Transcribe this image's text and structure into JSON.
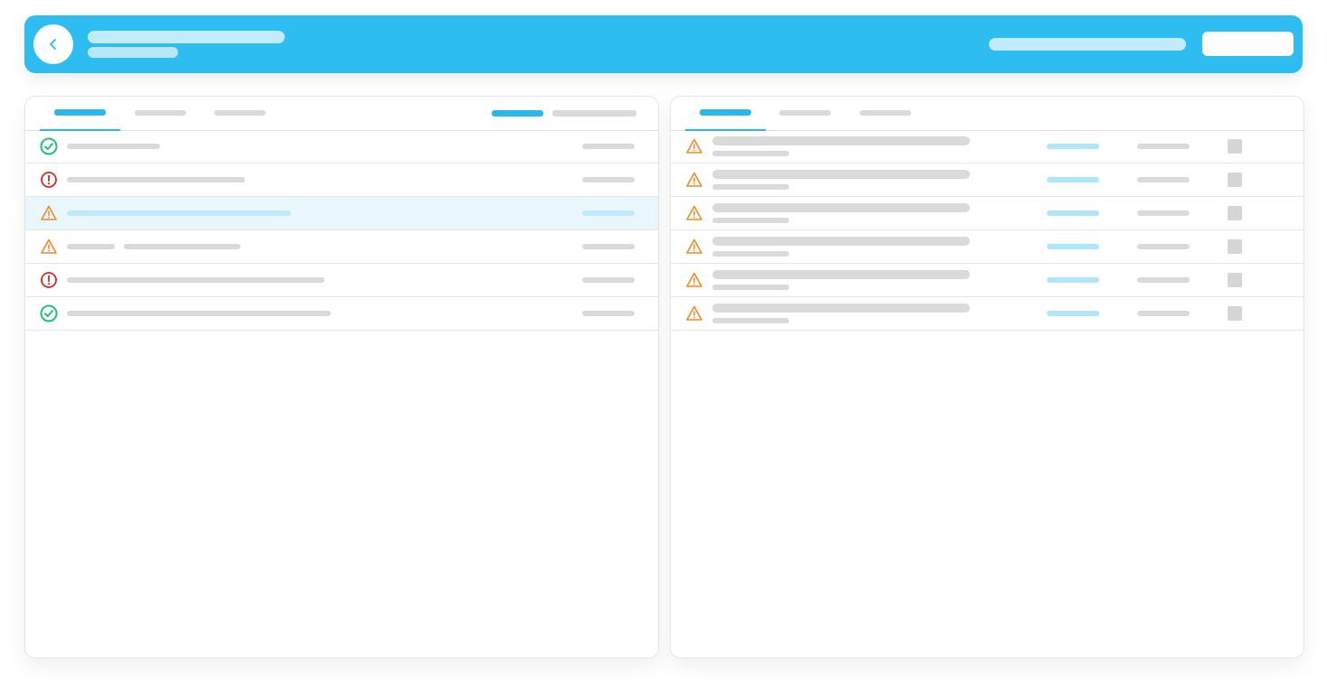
{
  "header": {
    "back_icon": "chevron-left-icon",
    "title": "",
    "subtitle": "",
    "meta": "",
    "action_label": ""
  },
  "left_panel": {
    "tabs": [
      {
        "label": "",
        "active": true
      },
      {
        "label": "",
        "active": false
      },
      {
        "label": "",
        "active": false
      }
    ],
    "toolbar": [
      {
        "label": "",
        "accent": true
      },
      {
        "label": "",
        "accent": false
      }
    ],
    "rows": [
      {
        "status": "success",
        "icon": "check-circle-icon",
        "text": "",
        "value": "",
        "highlighted": false
      },
      {
        "status": "error",
        "icon": "alert-circle-icon",
        "text": "",
        "value": "",
        "highlighted": false
      },
      {
        "status": "warning",
        "icon": "warning-triangle-icon",
        "text": "",
        "value": "",
        "highlighted": true
      },
      {
        "status": "warning",
        "icon": "warning-triangle-icon",
        "text": "",
        "text2": "",
        "value": "",
        "highlighted": false
      },
      {
        "status": "error",
        "icon": "alert-circle-icon",
        "text": "",
        "value": "",
        "highlighted": false
      },
      {
        "status": "success",
        "icon": "check-circle-icon",
        "text": "",
        "value": "",
        "highlighted": false
      }
    ]
  },
  "right_panel": {
    "tabs": [
      {
        "label": "",
        "active": true
      },
      {
        "label": "",
        "active": false
      },
      {
        "label": "",
        "active": false
      }
    ],
    "rows": [
      {
        "status": "warning",
        "icon": "warning-triangle-icon",
        "title": "",
        "subtitle": "",
        "tag": "",
        "value": ""
      },
      {
        "status": "warning",
        "icon": "warning-triangle-icon",
        "title": "",
        "subtitle": "",
        "tag": "",
        "value": ""
      },
      {
        "status": "warning",
        "icon": "warning-triangle-icon",
        "title": "",
        "subtitle": "",
        "tag": "",
        "value": ""
      },
      {
        "status": "warning",
        "icon": "warning-triangle-icon",
        "title": "",
        "subtitle": "",
        "tag": "",
        "value": ""
      },
      {
        "status": "warning",
        "icon": "warning-triangle-icon",
        "title": "",
        "subtitle": "",
        "tag": "",
        "value": ""
      },
      {
        "status": "warning",
        "icon": "warning-triangle-icon",
        "title": "",
        "subtitle": "",
        "tag": "",
        "value": ""
      }
    ]
  },
  "colors": {
    "accent": "#2dbdf0",
    "success": "#1ec27a",
    "error": "#e02424",
    "warning": "#f08a24",
    "placeholder": "#dadada"
  }
}
